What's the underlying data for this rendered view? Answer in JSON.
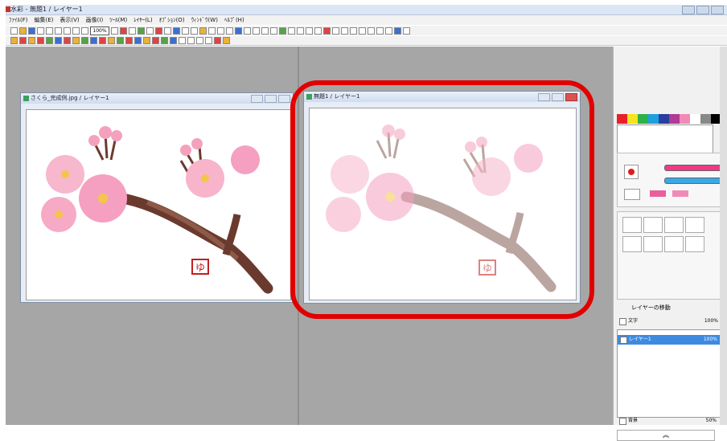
{
  "app": {
    "title": "水彩 - 無題1 / レイヤー1"
  },
  "menu": [
    "ﾌｧｲﾙ(F)",
    "編集(E)",
    "表示(V)",
    "画像(I)",
    "ﾂｰﾙ(M)",
    "ﾚｲﾔｰ(L)",
    "ｵﾌﾟｼｮﾝ(O)",
    "ｳｨﾝﾄﾞｳ(W)",
    "ﾍﾙﾌﾟ(H)"
  ],
  "toolbar": {
    "zoom": "100%"
  },
  "doc1": {
    "title": "さくら_完成例.jpg / レイヤー1",
    "stamp": "ゆ"
  },
  "doc2": {
    "title": "無題1 / レイヤー1",
    "stamp": "ゆ"
  },
  "layers": {
    "header": "レイヤーの移動",
    "rows": [
      {
        "name": "文字",
        "pct": "100%"
      },
      {
        "name": "レイヤー1",
        "pct": "100%"
      }
    ],
    "bg": {
      "name": "背景",
      "pct": "50%"
    },
    "collapse": "︽"
  },
  "colors": {
    "highlight": "#e10000",
    "accent": "#e21b1b"
  }
}
